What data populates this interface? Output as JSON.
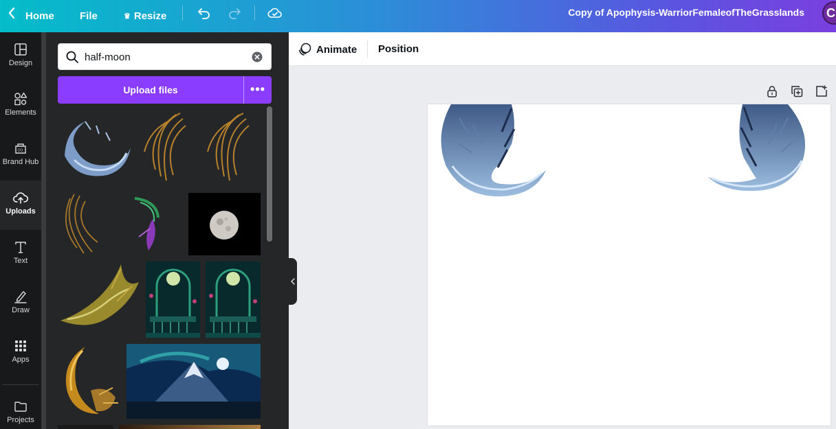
{
  "topbar": {
    "home_label": "Home",
    "file_label": "File",
    "resize_label": "Resize",
    "document_title": "Copy of Apophysis-WarriorFemaleofTheGrasslands",
    "avatar_initial": "C",
    "gradient_colors": [
      "#04bdc9",
      "#2c8ed8",
      "#5a55e0",
      "#7a3fe0"
    ]
  },
  "sidebar": {
    "items": [
      {
        "label": "Design",
        "icon": "layout-icon"
      },
      {
        "label": "Elements",
        "icon": "shapes-icon"
      },
      {
        "label": "Brand Hub",
        "icon": "brand-hub-icon"
      },
      {
        "label": "Uploads",
        "icon": "cloud-upload-icon",
        "active": true
      },
      {
        "label": "Text",
        "icon": "text-icon"
      },
      {
        "label": "Draw",
        "icon": "draw-pen-icon"
      },
      {
        "label": "Apps",
        "icon": "apps-grid-icon"
      },
      {
        "label": "Projects",
        "icon": "folder-icon"
      }
    ]
  },
  "panel": {
    "search_value": "half-moon",
    "upload_label": "Upload files",
    "more_label": "•••",
    "accent_color": "#8b3dff"
  },
  "toolbar": {
    "animate_label": "Animate",
    "position_label": "Position"
  }
}
